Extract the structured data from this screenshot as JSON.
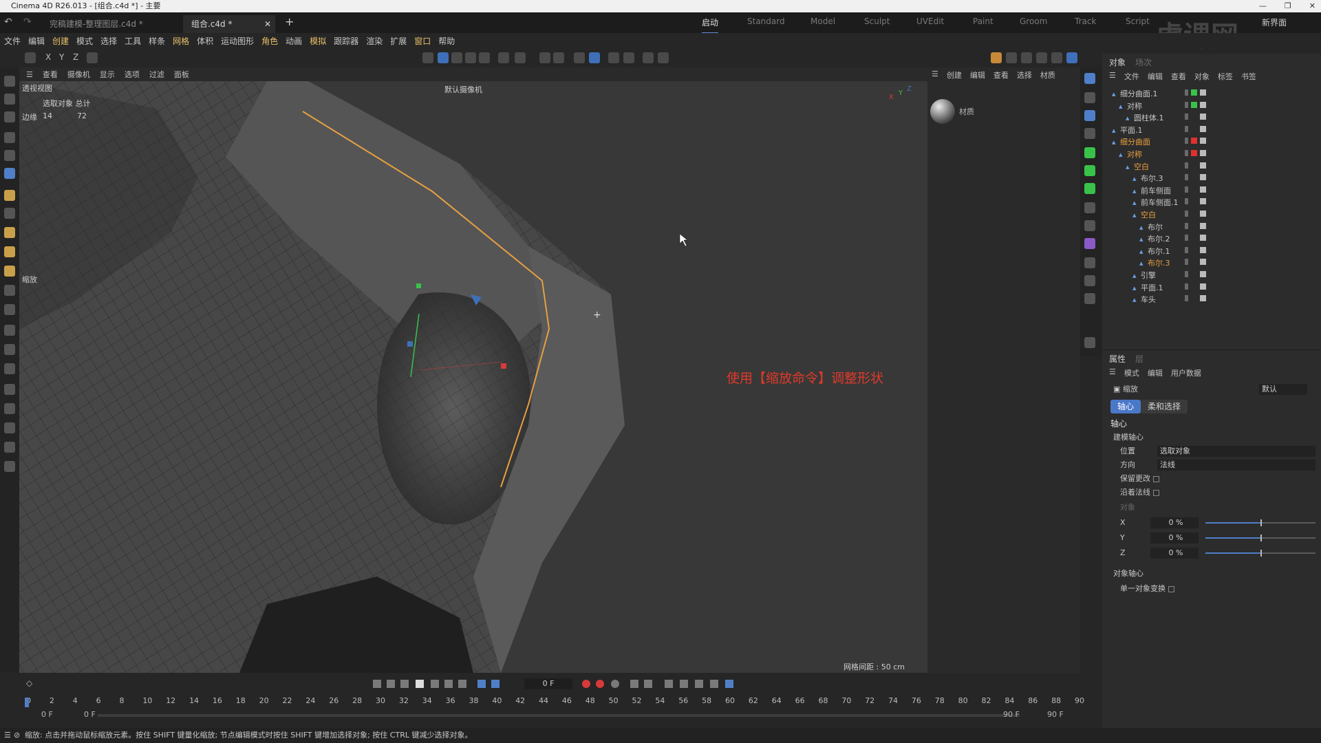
{
  "titlebar": {
    "title": "Cinema 4D R26.013 - [组合.c4d *] - 主要"
  },
  "doc_tabs": [
    "完稿建模-整理图层.c4d *",
    "组合.c4d *"
  ],
  "layout_tabs": [
    "启动",
    "Standard",
    "Model",
    "Sculpt",
    "UVEdit",
    "Paint",
    "Groom",
    "Track",
    "Script"
  ],
  "layout_right": "新界面",
  "menu": [
    "文件",
    "编辑",
    "创建",
    "模式",
    "选择",
    "工具",
    "样条",
    "网格",
    "体积",
    "运动图形",
    "角色",
    "动画",
    "模拟",
    "跟踪器",
    "渲染",
    "扩展",
    "窗口",
    "帮助"
  ],
  "viewport": {
    "menu": [
      "查看",
      "摄像机",
      "显示",
      "选项",
      "过滤",
      "面板"
    ],
    "name": "透视视图",
    "camera": "默认摄像机",
    "info_header": "选取对象  总计",
    "info_row_label": "边缘",
    "info_selected": "14",
    "info_total": "72",
    "tool_label": "缩放",
    "grid_info": "网格间距 : 50 cm",
    "annotation": "使用【缩放命令】调整形状",
    "annotation_color": "#e03a2a"
  },
  "material_panel": {
    "menu": [
      "创建",
      "编辑",
      "查看",
      "选择",
      "材质"
    ],
    "material_name": "材质"
  },
  "objects_panel": {
    "tabs": [
      "对象",
      "场次"
    ],
    "menu": [
      "文件",
      "编辑",
      "查看",
      "对象",
      "标签",
      "书签"
    ],
    "items": [
      {
        "name": "细分曲面.1",
        "level": 0,
        "hl": false
      },
      {
        "name": "对称",
        "level": 1,
        "hl": false
      },
      {
        "name": "圆柱体.1",
        "level": 2,
        "hl": false
      },
      {
        "name": "平面.1",
        "level": 0,
        "hl": false
      },
      {
        "name": "细分曲面",
        "level": 0,
        "hl": true
      },
      {
        "name": "对称",
        "level": 1,
        "hl": true
      },
      {
        "name": "空白",
        "level": 2,
        "hl": true
      },
      {
        "name": "布尔.3",
        "level": 3,
        "hl": false
      },
      {
        "name": "前车侧面",
        "level": 3,
        "hl": false
      },
      {
        "name": "前车侧面.1",
        "level": 3,
        "hl": false
      },
      {
        "name": "空白",
        "level": 3,
        "hl": true
      },
      {
        "name": "布尔",
        "level": 4,
        "hl": false
      },
      {
        "name": "布尔.2",
        "level": 4,
        "hl": false
      },
      {
        "name": "布尔.1",
        "level": 4,
        "hl": false
      },
      {
        "name": "布尔.3",
        "level": 4,
        "hl": true
      },
      {
        "name": "引擎",
        "level": 3,
        "hl": false
      },
      {
        "name": "平面.1",
        "level": 3,
        "hl": false
      },
      {
        "name": "车头",
        "level": 3,
        "hl": false
      }
    ]
  },
  "attributes_panel": {
    "tabs": [
      "属性",
      "层"
    ],
    "menu": [
      "模式",
      "编辑",
      "用户数据"
    ],
    "tool_name": "缩放",
    "preset": "默认",
    "sub_tabs": [
      "轴心",
      "柔和选择"
    ],
    "section": "轴心",
    "group1": "建模轴心",
    "position_label": "位置",
    "position_value": "选取对象",
    "direction_label": "方向",
    "direction_value": "法线",
    "keep_changes": "保留更改",
    "along_normal": "沿着法线",
    "object_label": "对象",
    "x_label": "X",
    "x_value": "0 %",
    "y_label": "Y",
    "y_value": "0 %",
    "z_label": "Z",
    "z_value": "0 %",
    "group2": "对象轴心",
    "single_object": "单一对象变换"
  },
  "timeline": {
    "current_frame": "0 F",
    "start": "0 F",
    "start2": "0 F",
    "end": "90 F",
    "end2": "90 F",
    "ticks": [
      "0",
      "2",
      "4",
      "6",
      "8",
      "10",
      "12",
      "14",
      "16",
      "18",
      "20",
      "22",
      "24",
      "26",
      "28",
      "30",
      "32",
      "34",
      "36",
      "38",
      "40",
      "42",
      "44",
      "46",
      "48",
      "50",
      "52",
      "54",
      "56",
      "58",
      "60",
      "62",
      "64",
      "66",
      "68",
      "70",
      "72",
      "74",
      "76",
      "78",
      "80",
      "82",
      "84",
      "86",
      "88",
      "90"
    ]
  },
  "statusbar": {
    "text": "缩放: 点击并拖动鼠标缩放元素。按住 SHIFT 键量化缩放; 节点编辑模式时按住 SHIFT 键增加选择对象; 按住 CTRL 键减少选择对象。"
  },
  "watermark": "虎课网"
}
